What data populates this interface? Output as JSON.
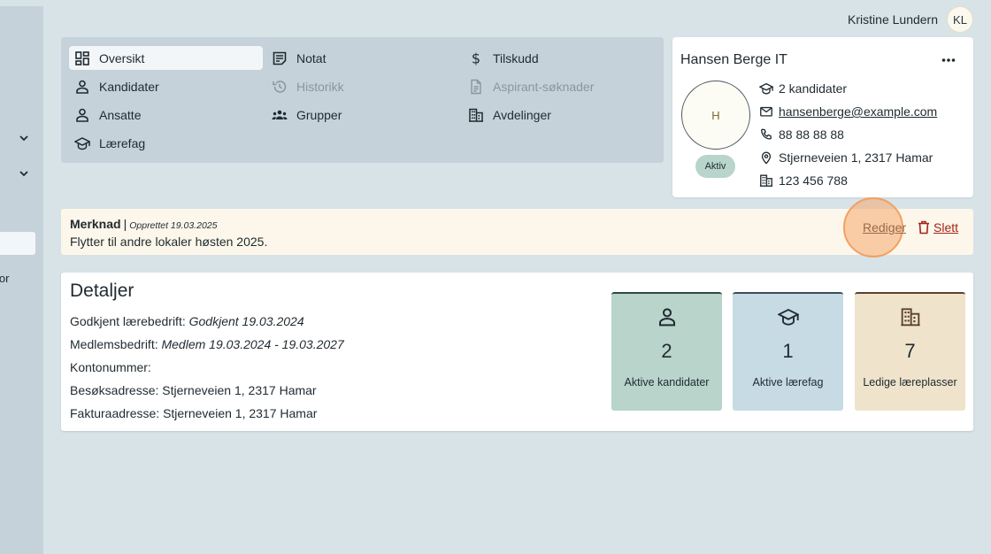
{
  "user": {
    "name": "Kristine Lundern",
    "initials": "KL"
  },
  "sidebar": {
    "fragment_text": "ntor"
  },
  "nav": {
    "items": [
      {
        "label": "Oversikt",
        "icon": "dashboard-icon",
        "active": true
      },
      {
        "label": "Notat",
        "icon": "note-icon"
      },
      {
        "label": "Tilskudd",
        "icon": "dollar-icon"
      },
      {
        "label": "Kandidater",
        "icon": "person-icon"
      },
      {
        "label": "Historikk",
        "icon": "history-icon",
        "disabled": true
      },
      {
        "label": "Aspirant-søknader",
        "icon": "document-icon",
        "disabled": true
      },
      {
        "label": "Ansatte",
        "icon": "person-icon"
      },
      {
        "label": "Grupper",
        "icon": "groups-icon"
      },
      {
        "label": "Avdelinger",
        "icon": "building-icon"
      },
      {
        "label": "Lærefag",
        "icon": "school-icon"
      }
    ]
  },
  "company": {
    "name": "Hansen Berge IT",
    "avatar_letter": "H",
    "status": "Aktiv",
    "candidates": "2 kandidater",
    "email": "hansenberge@example.com",
    "phone": "88 88 88 88",
    "address": "Stjerneveien 1, 2317 Hamar",
    "org_number": "123 456 788"
  },
  "note": {
    "title": "Merknad",
    "separator": "|",
    "created": "Opprettet 19.03.2025",
    "body": "Flytter til andre lokaler høsten 2025.",
    "edit_label": "Rediger",
    "delete_label": "Slett"
  },
  "details": {
    "title": "Detaljer",
    "rows": [
      {
        "label": "Godkjent lærebedrift:",
        "value": "Godkjent 19.03.2024",
        "italic": true
      },
      {
        "label": "Medlemsbedrift:",
        "value": "Medlem 19.03.2024 - 19.03.2027",
        "italic": true
      },
      {
        "label": "Kontonummer:",
        "value": ""
      },
      {
        "label": "Besøksadresse:",
        "value": "Stjerneveien 1, 2317 Hamar"
      },
      {
        "label": "Fakturaadresse:",
        "value": "Stjerneveien 1, 2317 Hamar"
      }
    ]
  },
  "stats": [
    {
      "value": "2",
      "label": "Aktive kandidater",
      "icon": "person-icon",
      "bg": "#b8d4cb",
      "border": "#2d4a44"
    },
    {
      "value": "1",
      "label": "Aktive lærefag",
      "icon": "school-icon",
      "bg": "#c7dbe4",
      "border": "#3a4f5a"
    },
    {
      "value": "7",
      "label": "Ledige læreplasser",
      "icon": "building-icon",
      "bg": "#efe3cb",
      "border": "#5a4030"
    }
  ]
}
